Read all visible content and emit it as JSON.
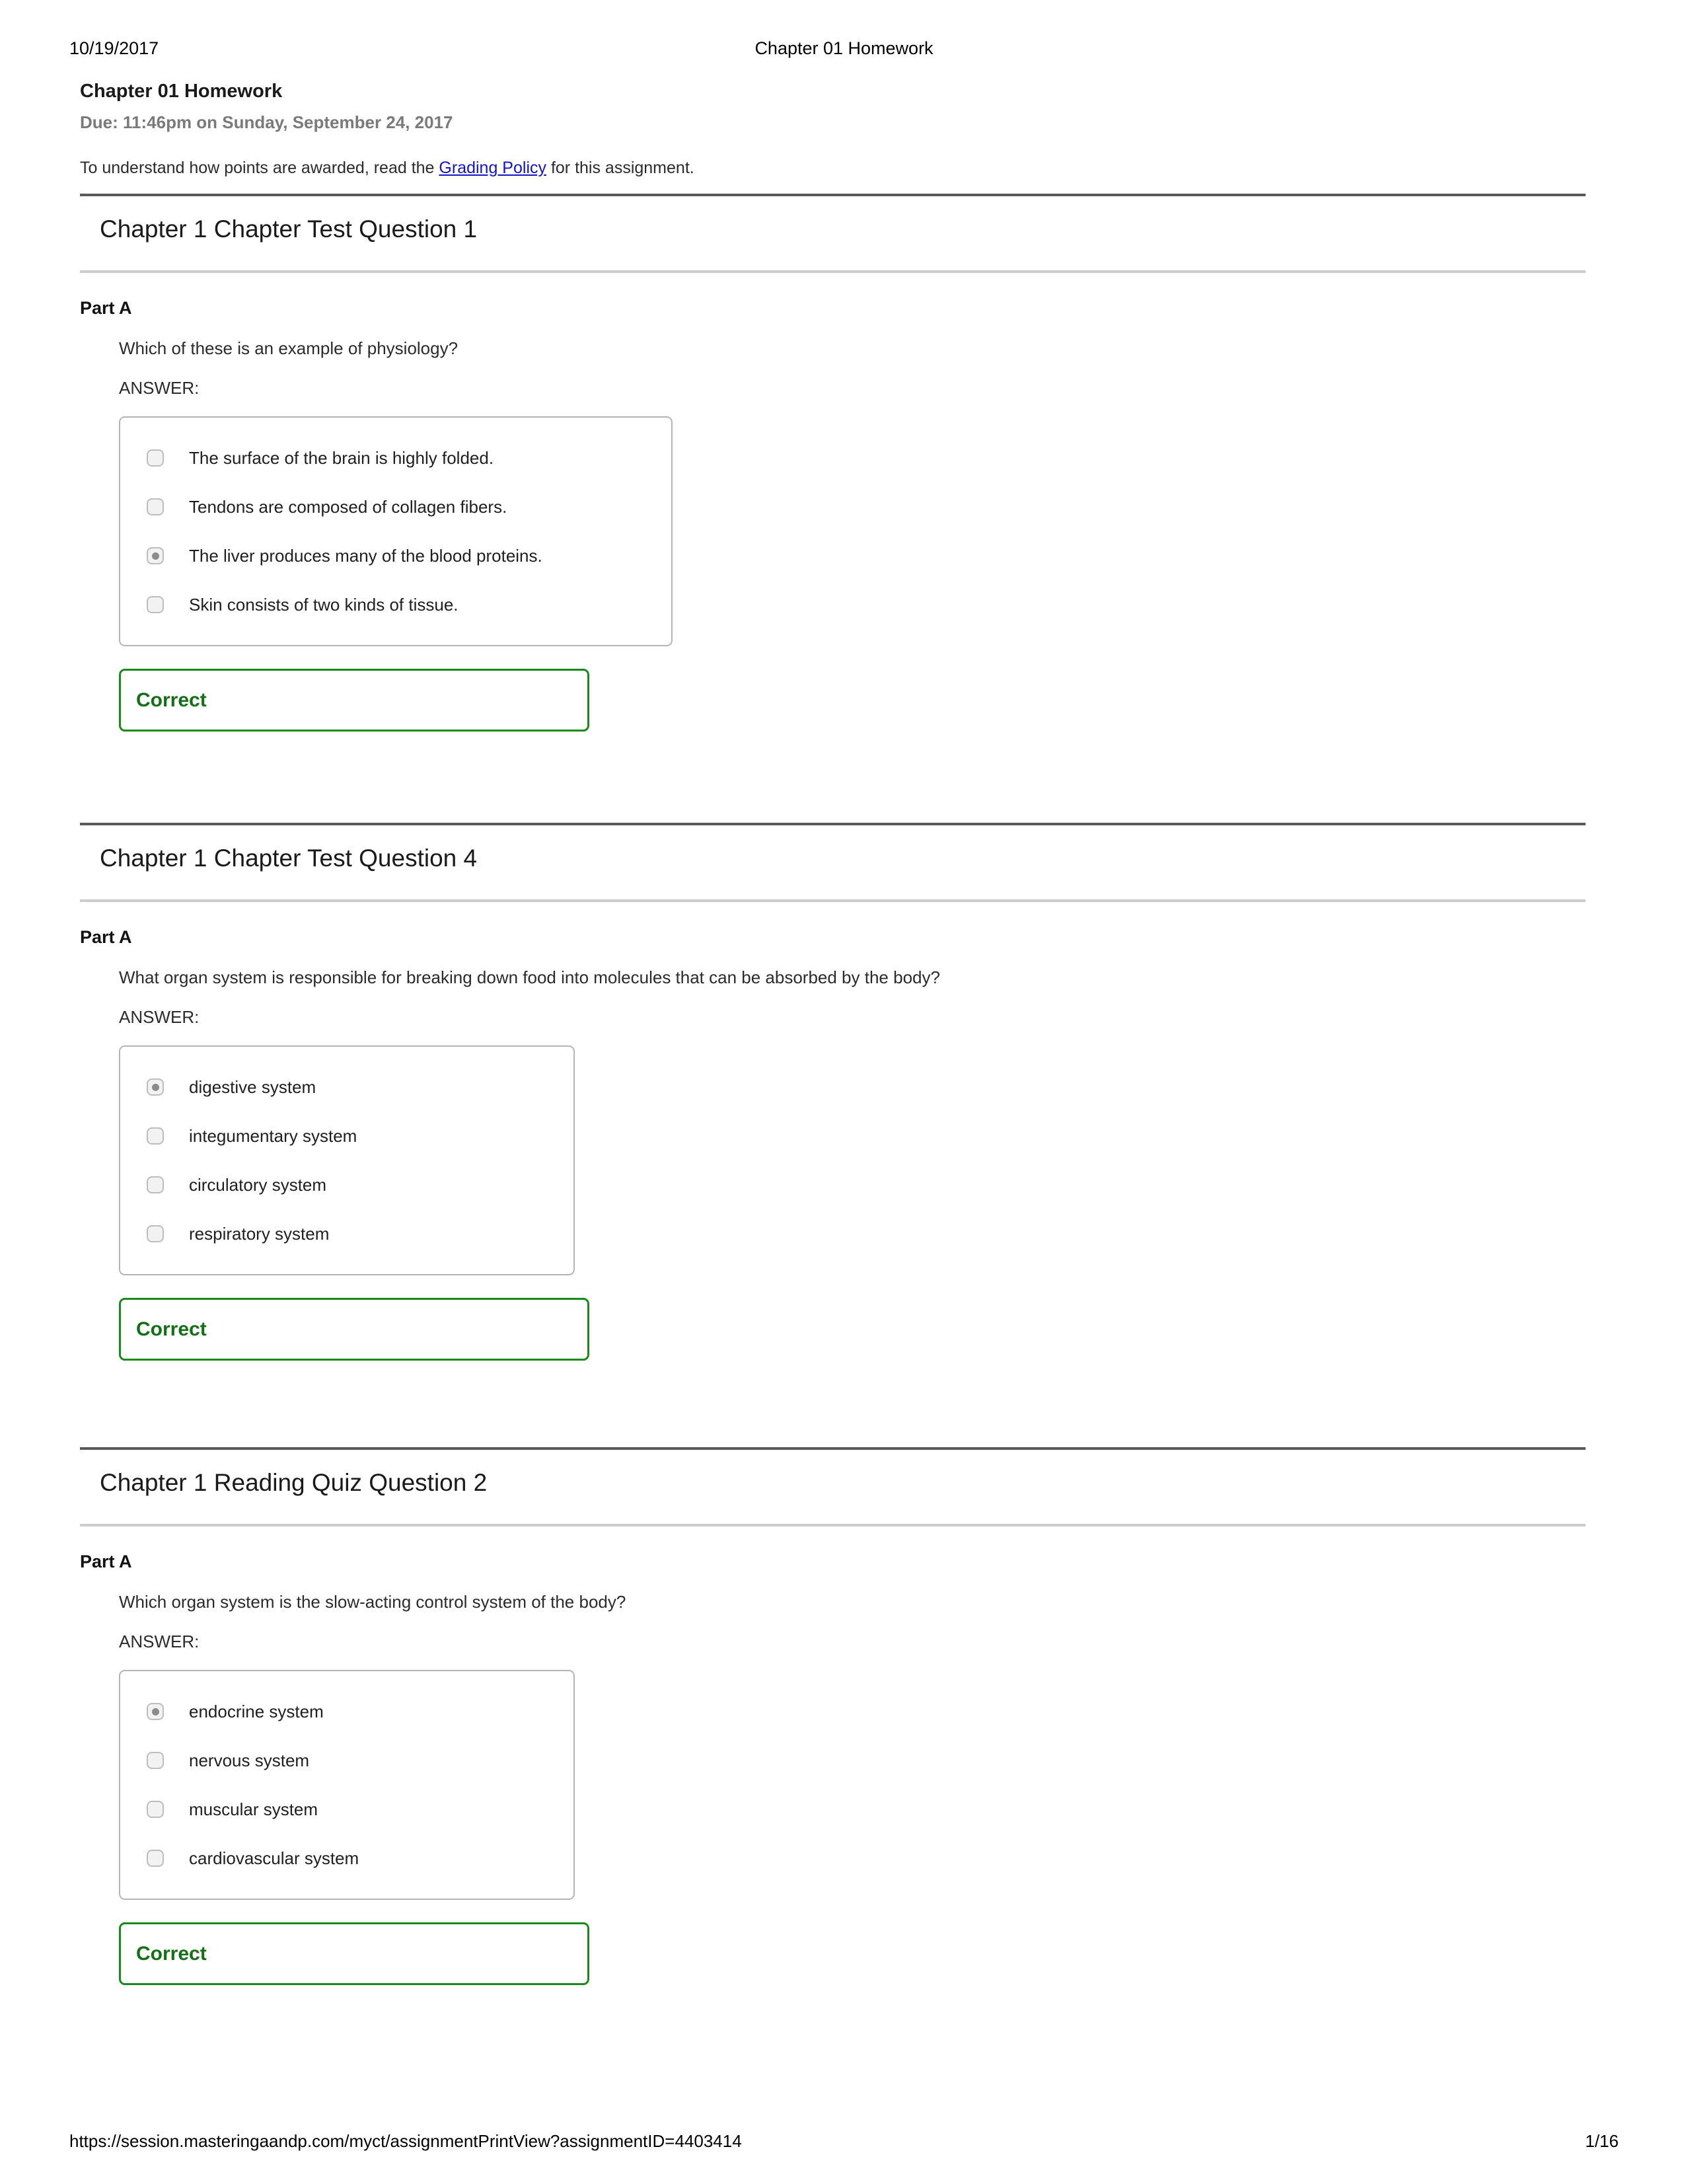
{
  "print_header": {
    "date": "10/19/2017",
    "document_title": "Chapter 01 Homework"
  },
  "assignment": {
    "title": "Chapter 01 Homework",
    "due": "Due: 11:46pm on Sunday, September 24, 2017",
    "grading_prefix": "To understand how points are awarded, read the ",
    "grading_link": "Grading Policy",
    "grading_suffix": " for this assignment."
  },
  "colors": {
    "rule_dark": "#5a5a5a",
    "rule_light": "#cccccc",
    "correct_border": "#1a8a1a",
    "correct_text": "#157015",
    "link": "#1414c8",
    "due_text": "#7a7a7a"
  },
  "problems": [
    {
      "title": "Chapter 1 Chapter Test Question 1",
      "part_label": "Part A",
      "question": "Which of these is an example of physiology?",
      "answer_label": "ANSWER:",
      "options": [
        {
          "label": "The surface of the brain is highly folded.",
          "selected": false
        },
        {
          "label": "Tendons are composed of collagen fibers.",
          "selected": false
        },
        {
          "label": "The liver produces many of the blood proteins.",
          "selected": true
        },
        {
          "label": "Skin consists of two kinds of tissue.",
          "selected": false
        }
      ],
      "result": "Correct"
    },
    {
      "title": "Chapter 1 Chapter Test Question 4",
      "part_label": "Part A",
      "question": "What organ system is responsible for breaking down food into molecules that can be absorbed by the body?",
      "answer_label": "ANSWER:",
      "options": [
        {
          "label": "digestive system",
          "selected": true
        },
        {
          "label": "integumentary system",
          "selected": false
        },
        {
          "label": "circulatory system",
          "selected": false
        },
        {
          "label": "respiratory system",
          "selected": false
        }
      ],
      "result": "Correct"
    },
    {
      "title": "Chapter 1 Reading Quiz Question 2",
      "part_label": "Part A",
      "question": "Which organ system is the slow-acting control system of the body?",
      "answer_label": "ANSWER:",
      "options": [
        {
          "label": "endocrine system",
          "selected": true
        },
        {
          "label": "nervous system",
          "selected": false
        },
        {
          "label": "muscular system",
          "selected": false
        },
        {
          "label": "cardiovascular system",
          "selected": false
        }
      ],
      "result": "Correct"
    }
  ],
  "print_footer": {
    "url": "https://session.masteringaandp.com/myct/assignmentPrintView?assignmentID=4403414",
    "page": "1/16"
  }
}
